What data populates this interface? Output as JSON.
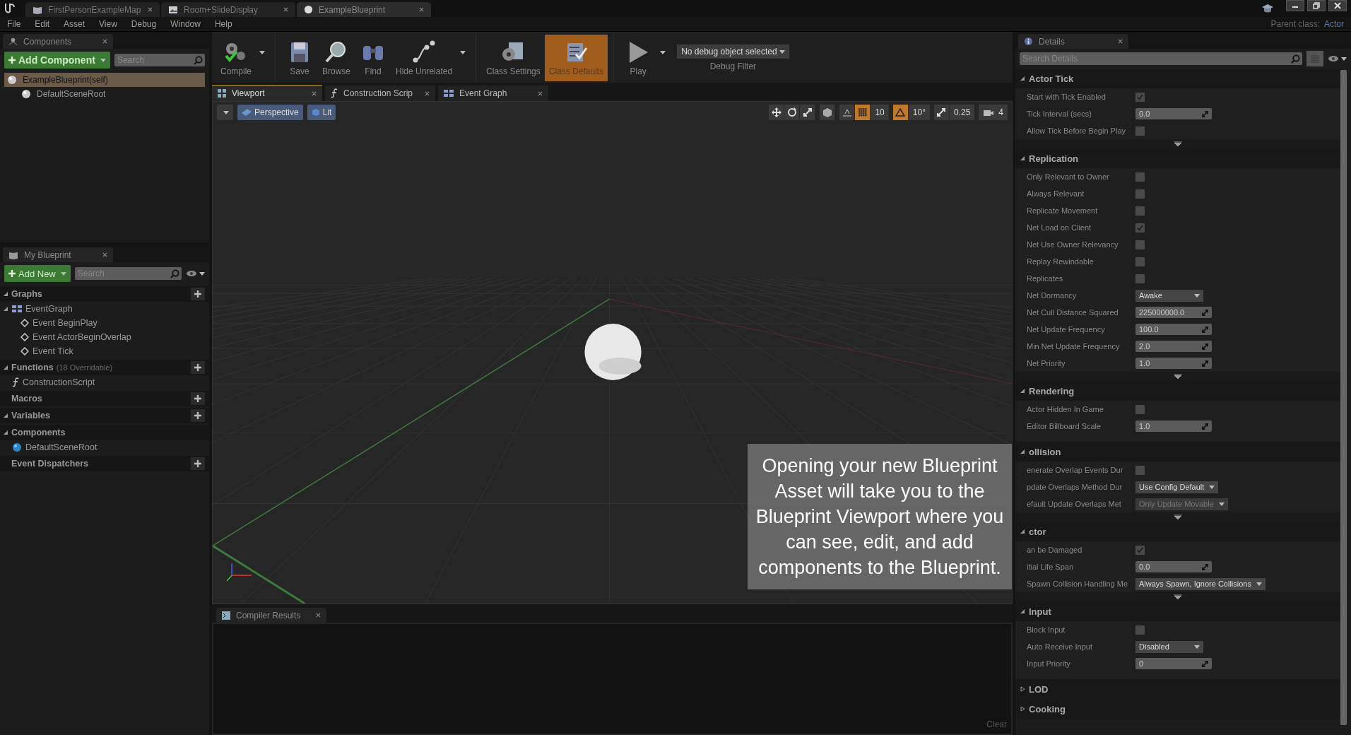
{
  "window": {
    "tabs": [
      {
        "label": "FirstPersonExampleMap",
        "kind": "map",
        "selected": false
      },
      {
        "label": "Room+SlideDisplay",
        "kind": "level",
        "selected": false
      },
      {
        "label": "ExampleBlueprint",
        "kind": "blueprint",
        "selected": true
      }
    ],
    "parent_class_label": "Parent class:",
    "parent_class": "Actor"
  },
  "menu": [
    "File",
    "Edit",
    "Asset",
    "View",
    "Debug",
    "Window",
    "Help"
  ],
  "toolbar": {
    "buttons": [
      {
        "kind": "compile",
        "label": "Compile",
        "dropdown": true,
        "selected": false
      },
      {
        "kind": "save",
        "label": "Save",
        "dropdown": false,
        "selected": false
      },
      {
        "kind": "browse",
        "label": "Browse",
        "dropdown": false,
        "selected": false
      },
      {
        "kind": "find",
        "label": "Find",
        "dropdown": false,
        "selected": false
      },
      {
        "kind": "hide_unrelated",
        "label": "Hide Unrelated",
        "dropdown": true,
        "selected": false
      },
      {
        "kind": "class_settings",
        "label": "Class Settings",
        "dropdown": false,
        "selected": false
      },
      {
        "kind": "class_defaults",
        "label": "Class Defaults",
        "dropdown": false,
        "selected": true
      },
      {
        "kind": "play",
        "label": "Play",
        "dropdown": true,
        "selected": false
      }
    ],
    "debug_object": "No debug object selected",
    "debug_filter": "Debug Filter"
  },
  "components_panel": {
    "title": "Components",
    "add_button": "Add Component",
    "search_placeholder": "Search",
    "tree": [
      {
        "label": "ExampleBlueprint(self)",
        "selected": true,
        "children": [
          {
            "label": "DefaultSceneRoot",
            "selected": false
          }
        ]
      }
    ]
  },
  "my_blueprint": {
    "title": "My Blueprint",
    "add_button": "Add New",
    "search_placeholder": "Search",
    "sections": [
      {
        "label": "Graphs",
        "addable": true,
        "expanded": true,
        "items": [
          {
            "label": "EventGraph",
            "kind": "graph",
            "expanded": true,
            "children": [
              {
                "label": "Event BeginPlay",
                "kind": "event"
              },
              {
                "label": "Event ActorBeginOverlap",
                "kind": "event"
              },
              {
                "label": "Event Tick",
                "kind": "event"
              }
            ]
          }
        ]
      },
      {
        "label": "Functions",
        "note": "(18 Overridable)",
        "addable": true,
        "expanded": true,
        "items": [
          {
            "label": "ConstructionScript",
            "kind": "function"
          }
        ]
      },
      {
        "label": "Macros",
        "addable": true,
        "expanded": false
      },
      {
        "label": "Variables",
        "addable": true,
        "expanded": true
      },
      {
        "label": "Components",
        "addable": false,
        "expanded": true,
        "items": [
          {
            "label": "DefaultSceneRoot",
            "kind": "component"
          }
        ]
      },
      {
        "label": "Event Dispatchers",
        "addable": true,
        "expanded": false
      }
    ]
  },
  "editor_tabs": [
    {
      "label": "Viewport",
      "kind": "viewport",
      "selected": true
    },
    {
      "label": "Construction Scrip",
      "kind": "function",
      "selected": false
    },
    {
      "label": "Event Graph",
      "kind": "graph",
      "selected": false
    }
  ],
  "viewport_toolbar": {
    "view_mode": "Perspective",
    "lighting": "Lit",
    "grid_snap": {
      "value": "10",
      "on": true
    },
    "rotation_snap": {
      "value": "10°",
      "on": true
    },
    "scale_snap": {
      "value": "0.25",
      "on": false
    },
    "camera_speed": "4"
  },
  "caption": "Opening your new Blueprint Asset will take you to the Blueprint Viewport where you can see, edit, and add components to the Blueprint.",
  "compiler_results": {
    "title": "Compiler Results",
    "clear": "Clear"
  },
  "details": {
    "title": "Details",
    "search_placeholder": "Search Details",
    "sections": [
      {
        "title": "Actor Tick",
        "expanded": true,
        "more": true,
        "rows": [
          {
            "label": "Start with Tick Enabled",
            "kind": "checkbox",
            "checked": true
          },
          {
            "label": "Tick Interval (secs)",
            "kind": "number",
            "value": "0.0"
          },
          {
            "label": "Allow Tick Before Begin Play",
            "kind": "checkbox",
            "checked": false
          }
        ]
      },
      {
        "title": "Replication",
        "expanded": true,
        "more": true,
        "rows": [
          {
            "label": "Only Relevant to Owner",
            "kind": "checkbox",
            "checked": false
          },
          {
            "label": "Always Relevant",
            "kind": "checkbox",
            "checked": false
          },
          {
            "label": "Replicate Movement",
            "kind": "checkbox",
            "checked": false
          },
          {
            "label": "Net Load on Client",
            "kind": "checkbox",
            "checked": true
          },
          {
            "label": "Net Use Owner Relevancy",
            "kind": "checkbox",
            "checked": false
          },
          {
            "label": "Replay Rewindable",
            "kind": "checkbox",
            "checked": false
          },
          {
            "label": "Replicates",
            "kind": "checkbox",
            "checked": false
          },
          {
            "label": "Net Dormancy",
            "kind": "dropdown",
            "value": "Awake",
            "disabled": false
          },
          {
            "label": "Net Cull Distance Squared",
            "kind": "number",
            "value": "225000000.0"
          },
          {
            "label": "Net Update Frequency",
            "kind": "number",
            "value": "100.0"
          },
          {
            "label": "Min Net Update Frequency",
            "kind": "number",
            "value": "2.0"
          },
          {
            "label": "Net Priority",
            "kind": "number",
            "value": "1.0"
          }
        ]
      },
      {
        "title": "Rendering",
        "expanded": true,
        "more": false,
        "rows": [
          {
            "label": "Actor Hidden In Game",
            "kind": "checkbox",
            "checked": false
          },
          {
            "label": "Editor Billboard Scale",
            "kind": "number",
            "value": "1.0"
          }
        ]
      },
      {
        "title": "ollision",
        "expanded": true,
        "more": true,
        "rows": [
          {
            "label": "enerate Overlap Events Dur",
            "kind": "checkbox",
            "checked": false
          },
          {
            "label": "pdate Overlaps Method Dur",
            "kind": "dropdown",
            "value": "Use Config Default",
            "disabled": false
          },
          {
            "label": "efault Update Overlaps Met",
            "kind": "dropdown",
            "value": "Only Update Movable",
            "disabled": true
          }
        ]
      },
      {
        "title": "ctor",
        "expanded": true,
        "more": true,
        "rows": [
          {
            "label": "an be Damaged",
            "kind": "checkbox",
            "checked": true
          },
          {
            "label": "itial Life Span",
            "kind": "number",
            "value": "0.0"
          },
          {
            "label": "Spawn Collision Handling Me",
            "kind": "dropdown",
            "value": "Always Spawn, Ignore Collisions",
            "disabled": false
          }
        ]
      },
      {
        "title": "Input",
        "expanded": true,
        "more": false,
        "rows": [
          {
            "label": "Block Input",
            "kind": "checkbox",
            "checked": false
          },
          {
            "label": "Auto Receive Input",
            "kind": "dropdown",
            "value": "Disabled",
            "disabled": false
          },
          {
            "label": "Input Priority",
            "kind": "number",
            "value": "0"
          }
        ]
      },
      {
        "title": "LOD",
        "expanded": false,
        "more": false
      },
      {
        "title": "Cooking",
        "expanded": false,
        "more": false
      }
    ]
  }
}
